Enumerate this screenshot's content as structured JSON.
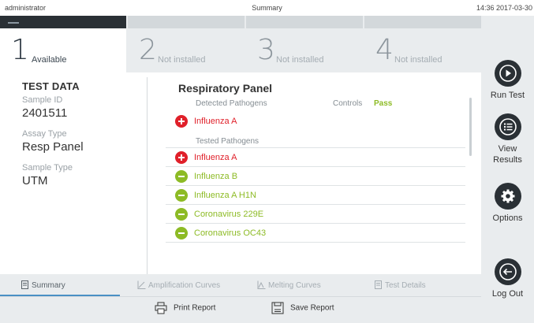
{
  "topbar": {
    "user": "administrator",
    "title": "Summary",
    "datetime": "14:36 2017-03-30"
  },
  "modules": [
    {
      "number": "1",
      "label": "Available",
      "active": true
    },
    {
      "number": "2",
      "label": "Not installed",
      "active": false
    },
    {
      "number": "3",
      "label": "Not installed",
      "active": false
    },
    {
      "number": "4",
      "label": "Not installed",
      "active": false
    }
  ],
  "sidebar": {
    "run_test": "Run Test",
    "view_results_1": "View",
    "view_results_2": "Results",
    "options": "Options",
    "log_out": "Log Out"
  },
  "test_data": {
    "heading": "TEST DATA",
    "sample_id_label": "Sample ID",
    "sample_id_value": "2401511",
    "assay_type_label": "Assay Type",
    "assay_type_value": "Resp Panel",
    "sample_type_label": "Sample Type",
    "sample_type_value": "UTM"
  },
  "panel": {
    "title": "Respiratory Panel",
    "detected_label": "Detected Pathogens",
    "controls_label": "Controls",
    "controls_value": "Pass",
    "detected": [
      {
        "name": "Influenza A",
        "status": "positive"
      }
    ],
    "tested_label": "Tested Pathogens",
    "tested": [
      {
        "name": "Influenza A",
        "status": "positive"
      },
      {
        "name": "Influenza B",
        "status": "negative"
      },
      {
        "name": "Influenza A H1N",
        "status": "negative"
      },
      {
        "name": "Coronavirus 229E",
        "status": "negative"
      },
      {
        "name": "Coronavirus OC43",
        "status": "negative"
      }
    ]
  },
  "tabs": [
    {
      "label": "Summary",
      "active": true
    },
    {
      "label": "Amplification Curves",
      "active": false
    },
    {
      "label": "Melting Curves",
      "active": false
    },
    {
      "label": "Test Details",
      "active": false
    }
  ],
  "actions": {
    "print": "Print Report",
    "save": "Save Report"
  },
  "colors": {
    "positive": "#e0202a",
    "negative": "#8dbb25",
    "dark": "#2a3035",
    "accent": "#4a90c4"
  }
}
